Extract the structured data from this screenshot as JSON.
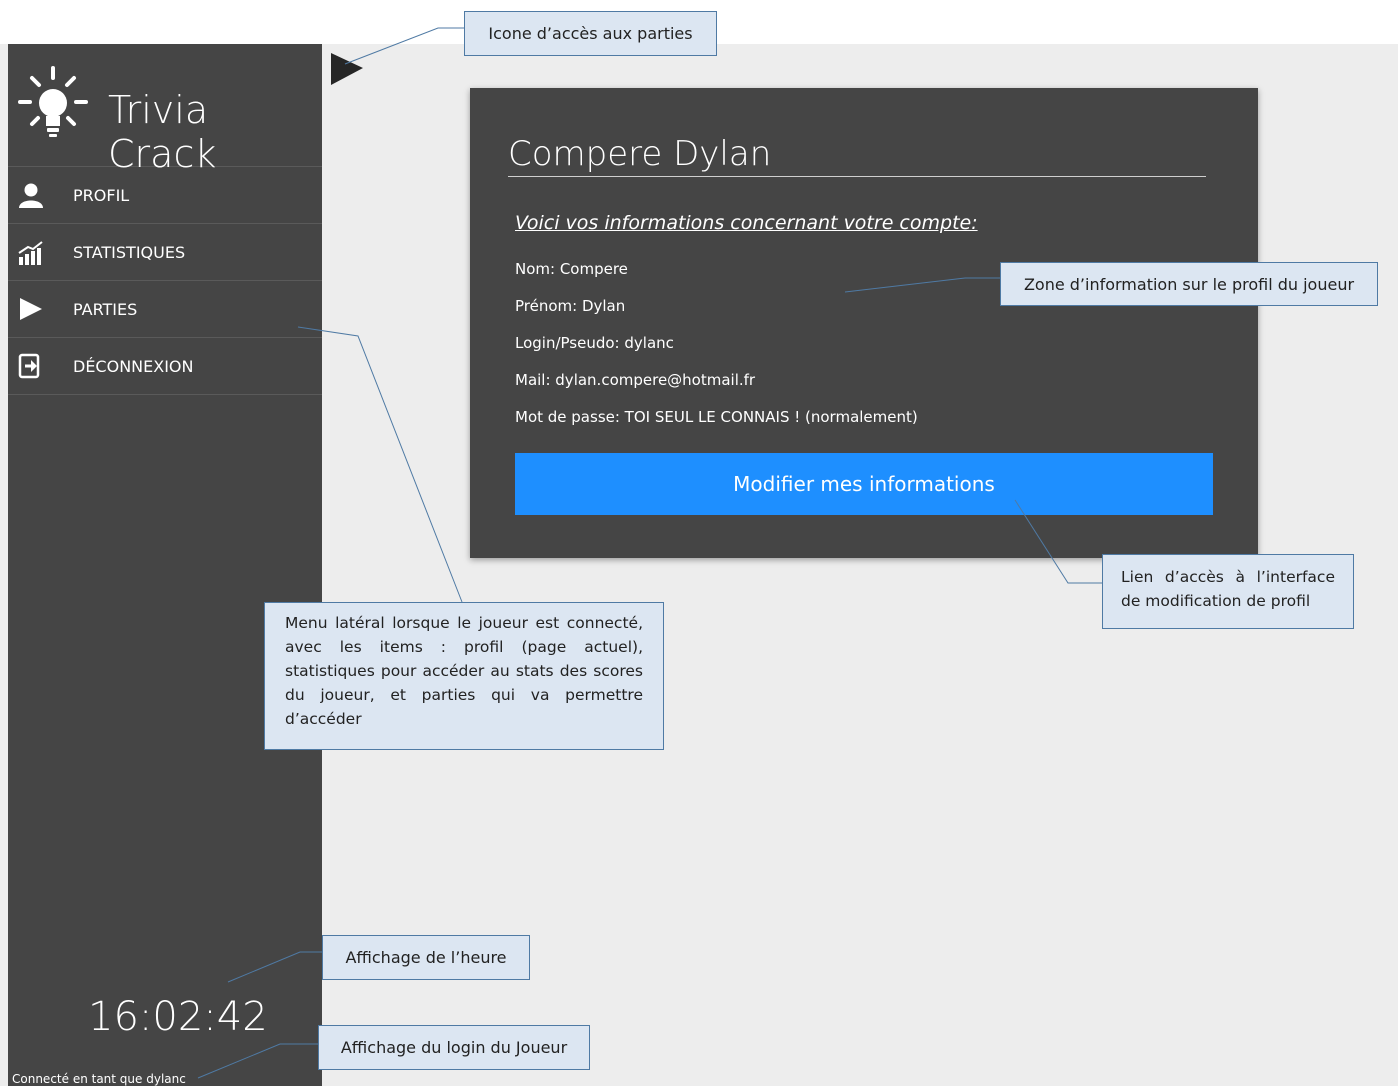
{
  "app": {
    "title": "Trivia Crack"
  },
  "sidebar": {
    "items": [
      {
        "label": "PROFIL",
        "icon": "user-icon"
      },
      {
        "label": "STATISTIQUES",
        "icon": "bar-chart-icon"
      },
      {
        "label": "PARTIES",
        "icon": "play-icon"
      },
      {
        "label": "DÉCONNEXION",
        "icon": "logout-icon"
      }
    ],
    "clock": "16:02:42",
    "login_status": "Connecté en tant que dylanc"
  },
  "profile": {
    "name": "Compere Dylan",
    "subtitle": "Voici vos informations concernant votre compte:",
    "lines": [
      "Nom: Compere",
      "Prénom: Dylan",
      "Login/Pseudo: dylanc",
      "Mail: dylan.compere@hotmail.fr",
      "Mot de passe: TOI SEUL LE CONNAIS ! (normalement)"
    ],
    "edit_button": "Modifier mes informations"
  },
  "annotations": {
    "games_icon": "Icone d’accès aux parties",
    "profile_zone": "Zone d’information sur le profil du joueur",
    "edit_link": "Lien d’accès à l’interface de modification de profil",
    "side_menu": "Menu latéral lorsque le joueur est connecté, avec les items : profil (page actuel), statistiques pour accéder au stats des scores du joueur, et parties qui va permettre d’accéder",
    "clock_display": "Affichage de l’heure",
    "login_display": "Affichage du login du Joueur"
  },
  "colors": {
    "sidebar_bg": "#454545",
    "card_bg": "#454545",
    "button_accent": "#1e8fff",
    "callout_bg": "#dce6f2",
    "callout_border": "#4f7aa4"
  }
}
